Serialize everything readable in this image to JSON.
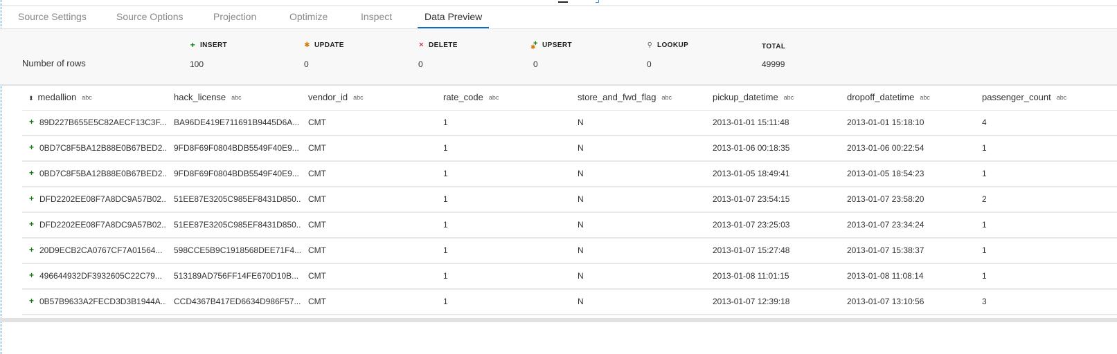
{
  "tabs": [
    {
      "label": "Source Settings",
      "active": false
    },
    {
      "label": "Source Options",
      "active": false
    },
    {
      "label": "Projection",
      "active": false
    },
    {
      "label": "Optimize",
      "active": false
    },
    {
      "label": "Inspect",
      "active": false
    },
    {
      "label": "Data Preview",
      "active": true
    }
  ],
  "summary": {
    "row_label": "Number of rows",
    "columns": [
      {
        "icon": "insert-icon",
        "label": "INSERT",
        "value": "100"
      },
      {
        "icon": "update-icon",
        "label": "UPDATE",
        "value": "0"
      },
      {
        "icon": "delete-icon",
        "label": "DELETE",
        "value": "0"
      },
      {
        "icon": "upsert-icon",
        "label": "UPSERT",
        "value": "0"
      },
      {
        "icon": "lookup-icon",
        "label": "LOOKUP",
        "value": "0"
      },
      {
        "icon": "",
        "label": "TOTAL",
        "value": "49999"
      }
    ]
  },
  "table": {
    "type_badge": "abc",
    "columns": [
      "medallion",
      "hack_license",
      "vendor_id",
      "rate_code",
      "store_and_fwd_flag",
      "pickup_datetime",
      "dropoff_datetime",
      "passenger_count"
    ],
    "rows": [
      [
        "89D227B655E5C82AECF13C3F...",
        "BA96DE419E711691B9445D6A...",
        "CMT",
        "1",
        "N",
        "2013-01-01 15:11:48",
        "2013-01-01 15:18:10",
        "4"
      ],
      [
        "0BD7C8F5BA12B88E0B67BED2...",
        "9FD8F69F0804BDB5549F40E9...",
        "CMT",
        "1",
        "N",
        "2013-01-06 00:18:35",
        "2013-01-06 00:22:54",
        "1"
      ],
      [
        "0BD7C8F5BA12B88E0B67BED2...",
        "9FD8F69F0804BDB5549F40E9...",
        "CMT",
        "1",
        "N",
        "2013-01-05 18:49:41",
        "2013-01-05 18:54:23",
        "1"
      ],
      [
        "DFD2202EE08F7A8DC9A57B02...",
        "51EE87E3205C985EF8431D850...",
        "CMT",
        "1",
        "N",
        "2013-01-07 23:54:15",
        "2013-01-07 23:58:20",
        "2"
      ],
      [
        "DFD2202EE08F7A8DC9A57B02...",
        "51EE87E3205C985EF8431D850...",
        "CMT",
        "1",
        "N",
        "2013-01-07 23:25:03",
        "2013-01-07 23:34:24",
        "1"
      ],
      [
        "20D9ECB2CA0767CF7A01564...",
        "598CCE5B9C1918568DEE71F4...",
        "CMT",
        "1",
        "N",
        "2013-01-07 15:27:48",
        "2013-01-07 15:38:37",
        "1"
      ],
      [
        "496644932DF3932605C22C79...",
        "513189AD756FF14FE670D10B...",
        "CMT",
        "1",
        "N",
        "2013-01-08 11:01:15",
        "2013-01-08 11:08:14",
        "1"
      ],
      [
        "0B57B9633A2FECD3D3B1944A...",
        "CCD4367B417ED6634D986F57...",
        "CMT",
        "1",
        "N",
        "2013-01-07 12:39:18",
        "2013-01-07 13:10:56",
        "3"
      ]
    ]
  }
}
